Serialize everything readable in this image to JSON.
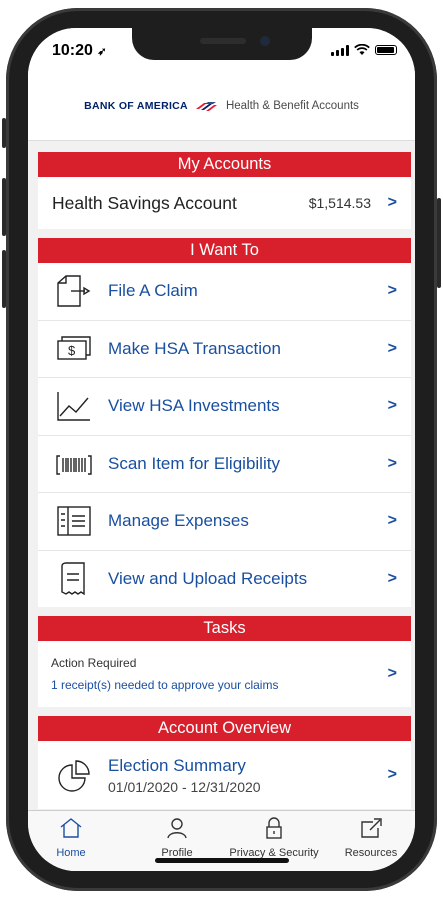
{
  "status": {
    "time": "10:20"
  },
  "header": {
    "bank": "BANK OF AMERICA",
    "subtitle": "Health & Benefit Accounts"
  },
  "my_accounts": {
    "title": "My Accounts",
    "account": {
      "name": "Health Savings Account",
      "balance": "$1,514.53"
    }
  },
  "i_want_to": {
    "title": "I Want To",
    "items": [
      {
        "label": "File A Claim",
        "icon": "file-claim-icon"
      },
      {
        "label": "Make HSA Transaction",
        "icon": "dollar-bill-icon"
      },
      {
        "label": "View HSA Investments",
        "icon": "line-chart-icon"
      },
      {
        "label": "Scan Item for Eligibility",
        "icon": "barcode-icon"
      },
      {
        "label": "Manage Expenses",
        "icon": "expenses-icon"
      },
      {
        "label": "View and Upload Receipts",
        "icon": "receipt-icon"
      }
    ]
  },
  "tasks": {
    "title": "Tasks",
    "status": "Action Required",
    "message": "1 receipt(s) needed to approve your claims"
  },
  "overview": {
    "title": "Account Overview",
    "item": {
      "label": "Election Summary",
      "dates": "01/01/2020 - 12/31/2020"
    }
  },
  "tabbar": {
    "tabs": [
      {
        "label": "Home",
        "icon": "home-icon"
      },
      {
        "label": "Profile",
        "icon": "person-icon"
      },
      {
        "label": "Privacy & Security",
        "icon": "lock-icon"
      },
      {
        "label": "Resources",
        "icon": "external-link-icon"
      }
    ]
  },
  "colors": {
    "accent_red": "#d81f2c",
    "link_blue": "#1a4fa0",
    "brand_navy": "#012169"
  }
}
